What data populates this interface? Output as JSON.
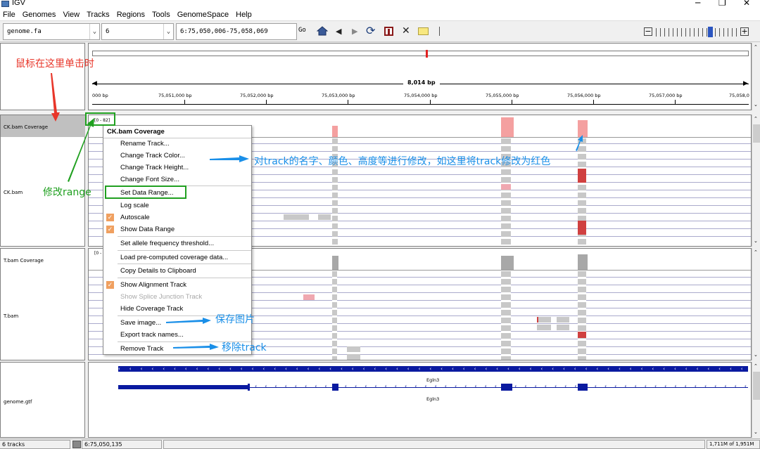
{
  "window": {
    "title": "IGV",
    "minimize": "─",
    "maximize": "❐",
    "close": "✕"
  },
  "menu": [
    "File",
    "Genomes",
    "View",
    "Tracks",
    "Regions",
    "Tools",
    "GenomeSpace",
    "Help"
  ],
  "toolbar": {
    "genome": "genome.fa",
    "chromosome": "6",
    "locus": "6:75,050,006-75,058,069",
    "go_label": "Go"
  },
  "ruler": {
    "span_label": "8,014 bp",
    "ticks": [
      "000 bp",
      "75,051,000 bp",
      "75,052,000 bp",
      "75,053,000 bp",
      "75,054,000 bp",
      "75,055,000 bp",
      "75,056,000 bp",
      "75,057,000 bp",
      "75,058,0"
    ]
  },
  "tracks": {
    "ck_coverage": "CK.bam Coverage",
    "ck_bam": "CK.bam",
    "t_coverage": "T.bam Coverage",
    "t_bam": "T.bam",
    "gtf": "genome.gtf",
    "ck_range": "[0 - 82]",
    "t_range": "[0 - 6"
  },
  "gene": {
    "name_top": "Egln3",
    "name_bottom": "Egln3"
  },
  "context_menu": {
    "header": "CK.bam Coverage",
    "items": [
      {
        "label": "Rename Track...",
        "enabled": true,
        "checked": false
      },
      {
        "label": "Change Track Color...",
        "enabled": true,
        "checked": false
      },
      {
        "label": "Change Track Height...",
        "enabled": true,
        "checked": false
      },
      {
        "label": "Change Font Size...",
        "enabled": true,
        "checked": false
      },
      {
        "label": "Set Data Range...",
        "enabled": true,
        "checked": false
      },
      {
        "label": "Log scale",
        "enabled": true,
        "checked": false
      },
      {
        "label": "Autoscale",
        "enabled": true,
        "checked": true
      },
      {
        "label": "Show Data Range",
        "enabled": true,
        "checked": true
      },
      {
        "label": "Set allele frequency threshold...",
        "enabled": true,
        "checked": false
      },
      {
        "label": "Load pre-computed coverage data...",
        "enabled": true,
        "checked": false
      },
      {
        "label": "Copy Details to Clipboard",
        "enabled": true,
        "checked": false
      },
      {
        "label": "Show Alignment Track",
        "enabled": true,
        "checked": true
      },
      {
        "label": "Show Splice Junction Track",
        "enabled": false,
        "checked": false
      },
      {
        "label": "Hide Coverage Track",
        "enabled": true,
        "checked": false
      },
      {
        "label": "Save image...",
        "enabled": true,
        "checked": false
      },
      {
        "label": "Export track names...",
        "enabled": true,
        "checked": false
      },
      {
        "label": "Remove Track",
        "enabled": true,
        "checked": false
      }
    ]
  },
  "annotations": {
    "click_here": "鼠标在这里单击时",
    "modify_range": "修改range",
    "modify_track": "对track的名字、颜色、高度等进行修改，如这里将track修改为红色",
    "save_image": "保存图片",
    "remove_track": "移除track"
  },
  "status": {
    "tracks_count": "6 tracks",
    "position": "6:75,050,135",
    "memory": "1,711M of 1,951M"
  },
  "colors": {
    "coverage_red": "#f4a0a0",
    "coverage_gray": "#a8a8a8",
    "gene_blue": "#0a1aa0",
    "annotation_red": "#e8362a",
    "annotation_green": "#20a020",
    "annotation_blue": "#1a8fe8"
  }
}
